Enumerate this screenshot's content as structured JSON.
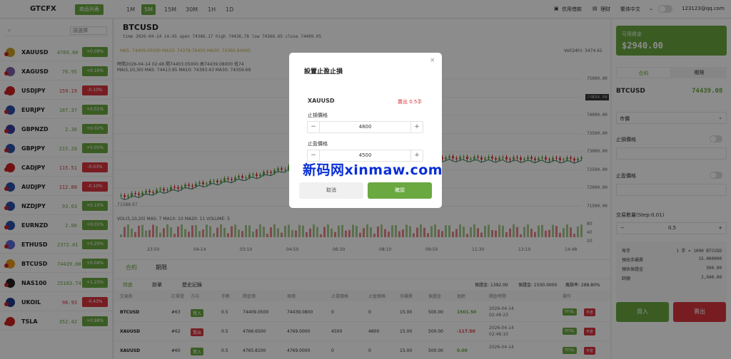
{
  "topbar": {
    "logo": "GTCFX",
    "list_button": "商品列表",
    "timeframes": [
      "1M",
      "5M",
      "15M",
      "30M",
      "1H",
      "1D"
    ],
    "active_timeframe": "5M",
    "credit": "信用借款",
    "finance": "理财",
    "language": "繁体中文",
    "user": "123123@qq.com"
  },
  "sidebar": {
    "search_placeholder": "",
    "filter": "請選擇",
    "items": [
      {
        "symbol": "XAUUSD",
        "price": "4769.00",
        "change": "+0.09%",
        "up": true
      },
      {
        "symbol": "XAGUSD",
        "price": "76.95",
        "change": "+0.16%",
        "up": true
      },
      {
        "symbol": "USDJPY",
        "price": "159.19",
        "change": "-0.10%",
        "up": false
      },
      {
        "symbol": "EURJPY",
        "price": "187.37",
        "change": "+0.01%",
        "up": true
      },
      {
        "symbol": "GBPNZD",
        "price": "2.30",
        "change": "+0.02%",
        "up": true
      },
      {
        "symbol": "GBPJPY",
        "price": "215.28",
        "change": "+0.05%",
        "up": true
      },
      {
        "symbol": "CADJPY",
        "price": "115.51",
        "change": "-0.03%",
        "up": false
      },
      {
        "symbol": "AUDJPY",
        "price": "112.88",
        "change": "-0.10%",
        "up": false
      },
      {
        "symbol": "NZDJPY",
        "price": "93.63",
        "change": "+0.10%",
        "up": true
      },
      {
        "symbol": "EURNZD",
        "price": "2.00",
        "change": "+0.01%",
        "up": true
      },
      {
        "symbol": "ETHUSD",
        "price": "2372.01",
        "change": "+0.20%",
        "up": true
      },
      {
        "symbol": "BTCUSD",
        "price": "74439.00",
        "change": "+0.04%",
        "up": true
      },
      {
        "symbol": "NAS100",
        "price": "25183.74",
        "change": "+1.23%",
        "up": true
      },
      {
        "symbol": "UKOIL",
        "price": "98.93",
        "change": "-0.43%",
        "up": false
      },
      {
        "symbol": "TSLA",
        "price": "352.42",
        "change": "+0.98%",
        "up": true
      }
    ]
  },
  "chart": {
    "symbol": "BTCUSD",
    "ohlc": "time 2026-04-14 14:45   open 74386.17   high 74436.78   low 74368.65   close 74409.05",
    "ma_line": "MA5: 74409.05000   MA10: 74378.76400   MA30: 74360.84000",
    "vol24": "Vol(24h): 3474.61",
    "info1": "時間2026-04-14 02:48  開74403.05000  高74439.08000  低74",
    "info2": "MA(5,10,30)   MA5: 74413.95   MA10: 74393.43   MA30: 74359.69",
    "current_price": "74439.08",
    "y_ticks": [
      "75000.00",
      "74500.00",
      "74000.00",
      "73500.00",
      "73000.00",
      "72500.00",
      "72000.00",
      "71500.00"
    ],
    "low_label": "71588.97",
    "vol_line": "VOL(5,10,20)   MA5: 7   MA10: 10   MA20: 11   VOLUME: 5",
    "vol_ticks": [
      "80",
      "40",
      "20"
    ],
    "x_ticks": [
      "23:50",
      "04-14",
      "03:10",
      "04:50",
      "06:30",
      "08:10",
      "09:50",
      "11:30",
      "13:10",
      "14:48"
    ]
  },
  "orders": {
    "tabs": [
      "合約",
      "期限"
    ],
    "subtabs": [
      "持倉",
      "掛單",
      "歷史記錄"
    ],
    "margin": "保證金: 1392.00",
    "deposit": "保證金: 1500.0000",
    "risk": "風險率: 288.80%",
    "columns": [
      "交易對",
      "訂單號",
      "方向",
      "手數",
      "開倉價",
      "現價",
      "止損價格",
      "止盈價格",
      "手續費",
      "保證金",
      "盈虧",
      "開倉時間",
      "操作"
    ],
    "rows": [
      {
        "pair": "BTCUSD",
        "id": "#63",
        "dir": "買入",
        "lots": "0.5",
        "open": "74409.0500",
        "now": "74439.0800",
        "sl": "0",
        "tp": "0",
        "fee": "15.00",
        "margin": "500.00",
        "pnl": "1501.50",
        "time1": "2026-04-14",
        "time2": "02:46:23",
        "buy": true
      },
      {
        "pair": "XAUUSD",
        "id": "#62",
        "dir": "賣出",
        "lots": "0.5",
        "open": "4766.6500",
        "now": "4769.0000",
        "sl": "4500",
        "tp": "4800",
        "fee": "15.00",
        "margin": "500.00",
        "pnl": "-117.50",
        "time1": "2026-04-14",
        "time2": "02:46:10",
        "buy": false
      },
      {
        "pair": "XAUUSD",
        "id": "#60",
        "dir": "買入",
        "lots": "0.5",
        "open": "4765.8100",
        "now": "4769.0000",
        "sl": "0",
        "tp": "0",
        "fee": "15.00",
        "margin": "500.00",
        "pnl": "0.00",
        "time1": "2026-04-14",
        "time2": "",
        "buy": true
      }
    ],
    "op1": "TP/SL",
    "op2": "平倉"
  },
  "right": {
    "balance_label": "可用資金",
    "balance": "$2940.00",
    "tabs": [
      "合約",
      "期限"
    ],
    "symbol": "BTCUSD",
    "price": "74439.08",
    "order_type": "市價",
    "sl_label": "止損價格",
    "tp_label": "止盈價格",
    "qty_label": "交易數量(Step:0.01)",
    "qty": "0.5",
    "minus": "−",
    "plus": "+",
    "info": [
      [
        "每手",
        "1 手 = 1000 BTCUSD"
      ],
      [
        "預估手續費",
        "15.000000"
      ],
      [
        "預估保證金",
        "500.00"
      ],
      [
        "餘額",
        "2,940.00"
      ]
    ],
    "buy": "買入",
    "sell": "賣出"
  },
  "modal": {
    "title": "設置止盈止損",
    "symbol": "XAUUSD",
    "side": "賣出 0.5手",
    "sl_label": "止損價格",
    "sl_value": "4800",
    "tp_label": "止盈價格",
    "tp_value": "4500",
    "cancel": "取消",
    "confirm": "確認",
    "close": "×"
  },
  "watermark": "新码网xinmaw.com",
  "colors": {
    "green": "#6aa840",
    "red": "#d9363e",
    "accent": "#6aa840"
  }
}
